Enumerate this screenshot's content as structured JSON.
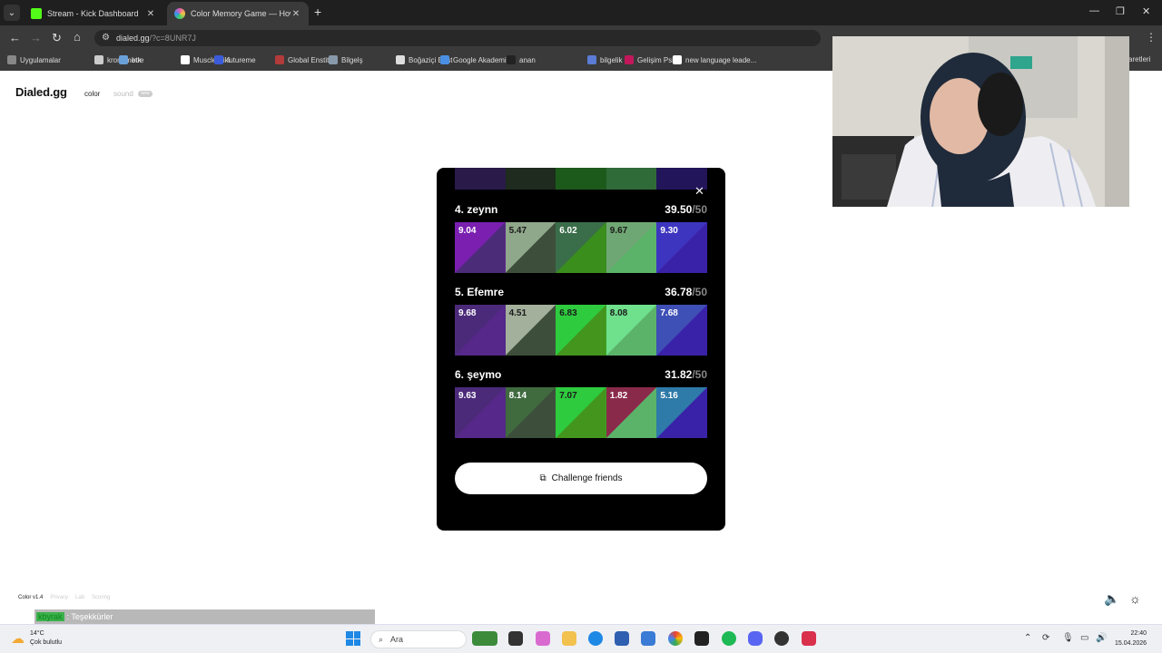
{
  "browser": {
    "tabs": [
      {
        "title": "Stream - Kick Dashboard",
        "favicon_color": "#53fc18",
        "active": false
      },
      {
        "title": "Color Memory Game — How W",
        "favicon_color": "#e85ab0",
        "active": true
      }
    ],
    "new_tab_icon": "plus-icon",
    "url_host": "dialed.gg",
    "url_rest": "/?c=8UNR7J",
    "bookmarks": [
      {
        "label": "Uygulamalar",
        "color": "#888888"
      },
      {
        "label": "kronometre",
        "color": "#cccccc"
      },
      {
        "label": "btk",
        "color": "#6aa0d8"
      },
      {
        "label": "MuscleWiki",
        "color": "#ffffff"
      },
      {
        "label": "futureme",
        "color": "#3b5bdb"
      },
      {
        "label": "Global Enstitü",
        "color": "#b33b3b"
      },
      {
        "label": "Bilgelş",
        "color": "#8899aa"
      },
      {
        "label": "Boğaziçi Enst",
        "color": "#dddddd"
      },
      {
        "label": "Google Akademik",
        "color": "#4a90e2"
      },
      {
        "label": "anan",
        "color": "#222222"
      },
      {
        "label": "bilgelik",
        "color": "#5b7bd5"
      },
      {
        "label": "Gelişim Psik",
        "color": "#c2185b"
      },
      {
        "label": "new language leade...",
        "color": "#ffffff"
      },
      {
        "label": "aretleri",
        "color": "#3a3a3a"
      }
    ]
  },
  "site": {
    "logo": "Dialed.gg",
    "nav_color": "color",
    "nav_sound": "sound",
    "badge": "new",
    "footer": {
      "version": "Color v1.4",
      "privacy": "Privacy",
      "lab": "Lab",
      "scoring": "Scoring"
    }
  },
  "leaderboard": {
    "top_strip_colors": [
      "#2a1a4a",
      "#1e2b1e",
      "#1c5a1c",
      "#2f6b38",
      "#23155a"
    ],
    "entries": [
      {
        "rank_name": "4. zeynn",
        "score": "39.50",
        "max": "/50",
        "rounds": [
          {
            "value": "9.04",
            "target": "#7a1fb0",
            "guess": "#4b2c78"
          },
          {
            "value": "5.47",
            "target": "#8fa78a",
            "guess": "#3d4f3b"
          },
          {
            "value": "6.02",
            "target": "#3a6e4a",
            "guess": "#3a8f1c"
          },
          {
            "value": "9.67",
            "target": "#6fa774",
            "guess": "#5bb36a"
          },
          {
            "value": "9.30",
            "target": "#3d35c0",
            "guess": "#3a22a8"
          }
        ]
      },
      {
        "rank_name": "5. Efemre",
        "score": "36.78",
        "max": "/50",
        "rounds": [
          {
            "value": "9.68",
            "target": "#4b2a7a",
            "guess": "#55288a"
          },
          {
            "value": "4.51",
            "target": "#a3b09c",
            "guess": "#3d4f3b"
          },
          {
            "value": "6.83",
            "target": "#2ecb3f",
            "guess": "#43951e"
          },
          {
            "value": "8.08",
            "target": "#6fe08c",
            "guess": "#5bb36a"
          },
          {
            "value": "7.68",
            "target": "#3e4fb5",
            "guess": "#3a22a8"
          }
        ]
      },
      {
        "rank_name": "6. şeymo",
        "score": "31.82",
        "max": "/50",
        "rounds": [
          {
            "value": "9.63",
            "target": "#4b2a7a",
            "guess": "#55288a"
          },
          {
            "value": "8.14",
            "target": "#3f6b3f",
            "guess": "#3d4f3b"
          },
          {
            "value": "7.07",
            "target": "#2ecb3f",
            "guess": "#43951e"
          },
          {
            "value": "1.82",
            "target": "#8a2a4a",
            "guess": "#5bb36a"
          },
          {
            "value": "5.16",
            "target": "#2e7aa8",
            "guess": "#3a22a8"
          }
        ]
      }
    ],
    "challenge_label": "Challenge friends",
    "close_icon": "close-icon"
  },
  "chat": {
    "user": "kbyrak",
    "message": ": Teşekkürler"
  },
  "taskbar": {
    "temperature": "14°C",
    "weather": "Çok bulutlu",
    "search_placeholder": "Ara",
    "time": "22:40",
    "date": "15.04.2026"
  }
}
